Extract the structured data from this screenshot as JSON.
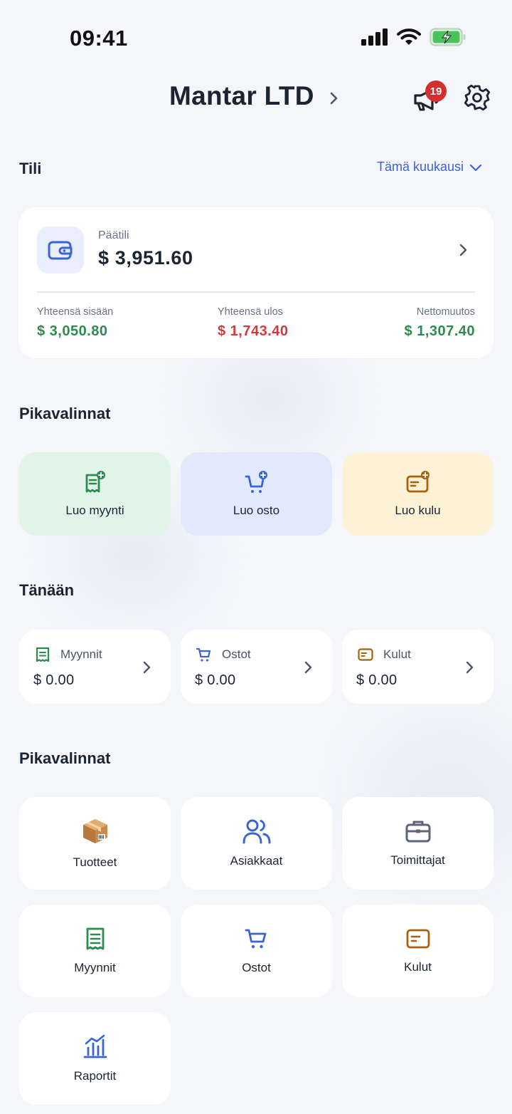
{
  "status_bar": {
    "time": "09:41"
  },
  "header": {
    "company": "Mantar LTD",
    "notifications_count": "19"
  },
  "account_section": {
    "title": "Tili",
    "period": "Tämä kuukausi",
    "account": {
      "name": "Päätili",
      "balance": "$ 3,951.60",
      "total_in_label": "Yhteensä sisään",
      "total_in": "$ 3,050.80",
      "total_out_label": "Yhteensä ulos",
      "total_out": "$ 1,743.40",
      "net_label": "Nettomuutos",
      "net": "$ 1,307.40"
    }
  },
  "quick_create": {
    "title": "Pikavalinnat",
    "items": [
      {
        "label": "Luo myynti",
        "icon": "receipt-add-icon",
        "bg": "#e0f5e8",
        "color": "#2e8b4f"
      },
      {
        "label": "Luo osto",
        "icon": "cart-add-icon",
        "bg": "#e3e9fc",
        "color": "#3a63d8"
      },
      {
        "label": "Luo kulu",
        "icon": "card-add-icon",
        "bg": "#fdf1d6",
        "color": "#a8620f"
      }
    ]
  },
  "today": {
    "title": "Tänään",
    "items": [
      {
        "label": "Myynnit",
        "value": "$ 0.00",
        "icon": "receipt-icon"
      },
      {
        "label": "Ostot",
        "value": "$ 0.00",
        "icon": "cart-icon"
      },
      {
        "label": "Kulut",
        "value": "$ 0.00",
        "icon": "card-icon"
      }
    ]
  },
  "shortcuts": {
    "title": "Pikavalinnat",
    "items": [
      {
        "label": "Tuotteet",
        "icon": "package-icon"
      },
      {
        "label": "Asiakkaat",
        "icon": "users-icon"
      },
      {
        "label": "Toimittajat",
        "icon": "briefcase-icon"
      },
      {
        "label": "Myynnit",
        "icon": "receipt-icon"
      },
      {
        "label": "Ostot",
        "icon": "cart-icon"
      },
      {
        "label": "Kulut",
        "icon": "card-icon"
      },
      {
        "label": "Raportit",
        "icon": "chart-icon"
      }
    ]
  },
  "colors": {
    "accent": "#3a63d8",
    "positive": "#2e8b4f",
    "negative": "#d23b3b",
    "expense": "#a8620f"
  }
}
